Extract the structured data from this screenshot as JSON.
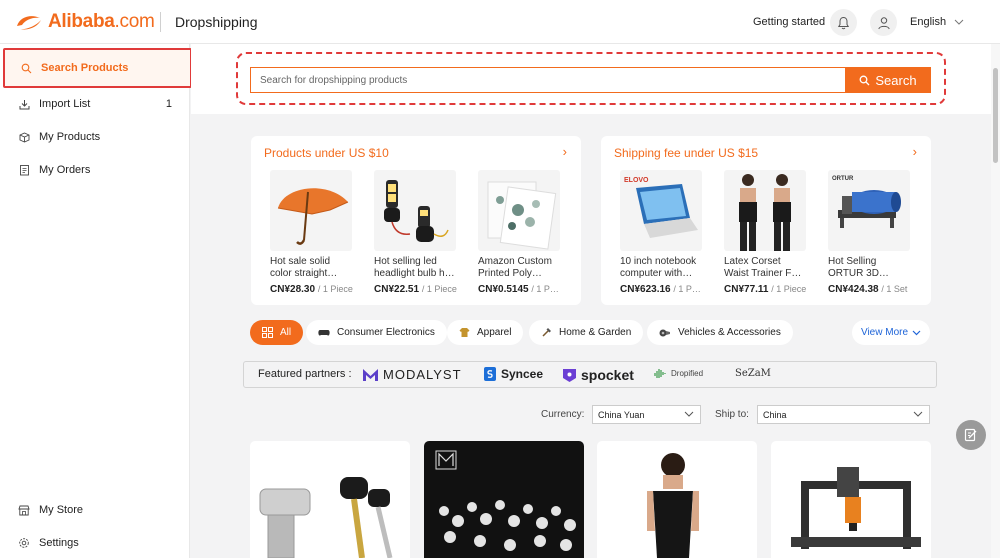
{
  "header": {
    "logo_text": "Alibaba",
    "logo_suffix": ".com",
    "title": "Dropshipping",
    "getting_started": "Getting started",
    "language": "English",
    "icons": [
      "bell-icon",
      "user-icon",
      "chevron-down-icon"
    ]
  },
  "sidebar": {
    "items": [
      {
        "label": "Search Products",
        "icon": "search-icon",
        "active": true
      },
      {
        "label": "Import List",
        "icon": "import-icon",
        "count": "1"
      },
      {
        "label": "My Products",
        "icon": "box-icon"
      },
      {
        "label": "My Orders",
        "icon": "orders-icon"
      },
      {
        "label": "My Store",
        "icon": "store-icon"
      },
      {
        "label": "Settings",
        "icon": "gear-icon"
      }
    ]
  },
  "search": {
    "placeholder": "Search for dropshipping products",
    "button_label": "Search"
  },
  "promo_cards": [
    {
      "title": "Products under US $10",
      "products": [
        {
          "name": "Hot sale solid color straight…",
          "price": "CN¥28.30",
          "unit": "/ 1 Piece"
        },
        {
          "name": "Hot selling led headlight bulb h…",
          "price": "CN¥22.51",
          "unit": "/ 1 Piece"
        },
        {
          "name": "Amazon Custom Printed Poly…",
          "price": "CN¥0.5145",
          "unit": "/ 1 P…"
        }
      ]
    },
    {
      "title": "Shipping fee under US $15",
      "products": [
        {
          "name": "10 inch notebook computer with…",
          "price": "CN¥623.16",
          "unit": "/ 1 P…"
        },
        {
          "name": "Latex Corset Waist Trainer F…",
          "price": "CN¥77.11",
          "unit": "/ 1 Piece"
        },
        {
          "name": "Hot Selling ORTUR 3D…",
          "price": "CN¥424.38",
          "unit": "/ 1 Set"
        }
      ]
    }
  ],
  "categories": {
    "items": [
      "All",
      "Consumer Electronics",
      "Apparel",
      "Home & Garden",
      "Vehicles & Accessories"
    ],
    "view_more": "View More"
  },
  "partners": {
    "label": "Featured partners :",
    "names": [
      "MODALYST",
      "Syncee",
      "spocket",
      "Dropified",
      "SeZaM"
    ]
  },
  "filters": {
    "currency_label": "Currency:",
    "currency_value": "China Yuan",
    "ship_label": "Ship to:",
    "ship_value": "China"
  },
  "colors": {
    "accent": "#f26b1d",
    "link": "#1e64d8",
    "highlight": "#e03a3a"
  }
}
